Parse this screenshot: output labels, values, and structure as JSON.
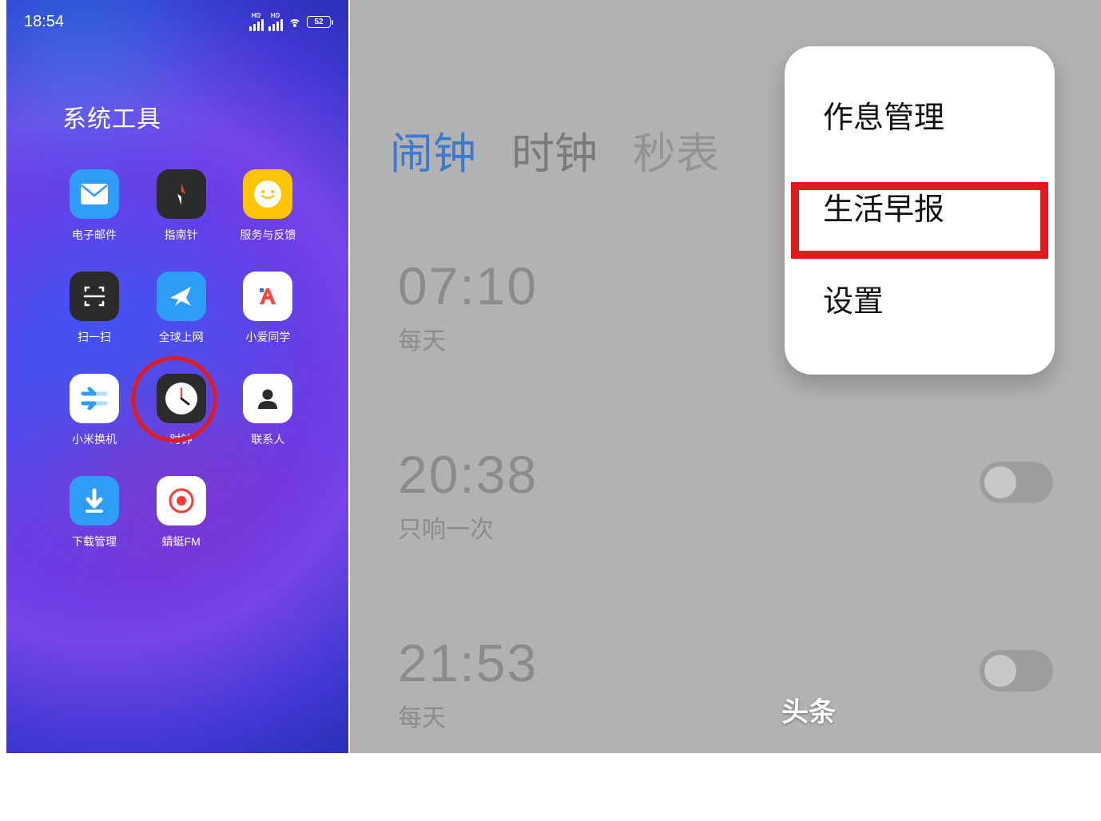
{
  "statusbar": {
    "time": "18:54",
    "hd_label": "HD",
    "battery": "52"
  },
  "folder": {
    "title": "系统工具"
  },
  "apps": [
    {
      "id": "mail",
      "label": "电子邮件"
    },
    {
      "id": "compass",
      "label": "指南针"
    },
    {
      "id": "feedback",
      "label": "服务与反馈"
    },
    {
      "id": "scan",
      "label": "扫一扫"
    },
    {
      "id": "global-net",
      "label": "全球上网"
    },
    {
      "id": "xiaoai",
      "label": "小爱同学"
    },
    {
      "id": "mi-mover",
      "label": "小米换机"
    },
    {
      "id": "clock",
      "label": "时钟"
    },
    {
      "id": "contacts",
      "label": "联系人"
    },
    {
      "id": "downloads",
      "label": "下载管理"
    },
    {
      "id": "qingting-fm",
      "label": "蜻蜓FM"
    }
  ],
  "clock_app": {
    "tabs": [
      "闹钟",
      "时钟",
      "秒表"
    ],
    "active_tab_index": 0,
    "alarms": [
      {
        "time": "07:10",
        "repeat": "每天",
        "enabled": false,
        "toggle_visible": false
      },
      {
        "time": "20:38",
        "repeat": "只响一次",
        "enabled": false,
        "toggle_visible": true
      },
      {
        "time": "21:53",
        "repeat": "每天",
        "enabled": false,
        "toggle_visible": true
      }
    ],
    "popup_menu": [
      "作息管理",
      "生活早报",
      "设置"
    ],
    "popup_highlight_index": 1
  },
  "watermark": "头条"
}
